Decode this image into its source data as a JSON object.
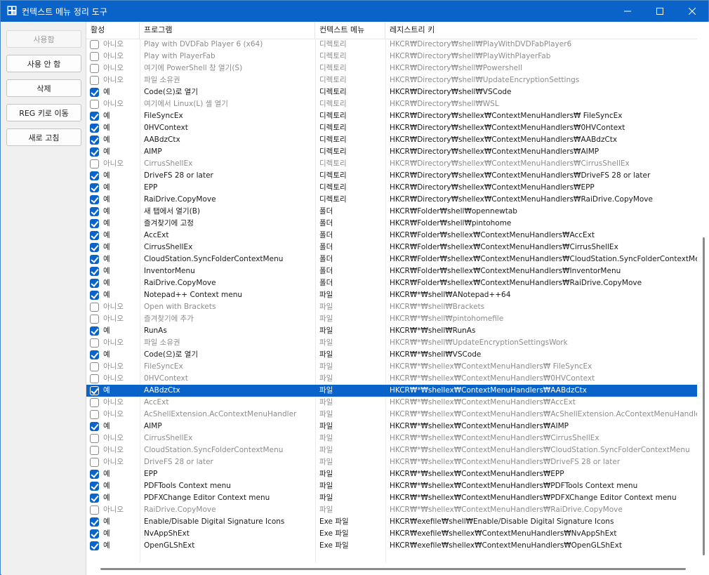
{
  "window": {
    "title": "컨텍스트 메뉴 정리 도구"
  },
  "colors": {
    "accent": "#0a63c9",
    "selection": "#0a63c9",
    "titlebar": "#0a63c9"
  },
  "icons": {
    "app": "registry-cube-icon",
    "minimize": "minimize-icon",
    "maximize": "maximize-icon",
    "close": "close-icon"
  },
  "sidebar": {
    "buttons": [
      {
        "label": "사용함",
        "enabled": false
      },
      {
        "label": "사용 안 함",
        "enabled": true
      },
      {
        "label": "삭제",
        "enabled": true
      },
      {
        "label": "REG 키로 이동",
        "enabled": true
      },
      {
        "label": "새로 고침",
        "enabled": true
      }
    ]
  },
  "table": {
    "columns": [
      "활성",
      "프로그램",
      "컨텍스트 메뉴",
      "레지스트리 키"
    ],
    "rows": [
      {
        "checked": false,
        "active": "아니오",
        "program": "Play with DVDFab Player 6 (x64)",
        "type": "디렉토리",
        "key": "HKCR₩Directory₩shell₩PlayWithDVDFabPlayer6"
      },
      {
        "checked": false,
        "active": "아니오",
        "program": "Play with PlayerFab",
        "type": "디렉토리",
        "key": "HKCR₩Directory₩shell₩PlayWithPlayerFab"
      },
      {
        "checked": false,
        "active": "아니오",
        "program": "여기에 PowerShell 창 열기(S)",
        "type": "디렉토리",
        "key": "HKCR₩Directory₩shell₩Powershell"
      },
      {
        "checked": false,
        "active": "아니오",
        "program": "파일 소유권",
        "type": "디렉토리",
        "key": "HKCR₩Directory₩shell₩UpdateEncryptionSettings"
      },
      {
        "checked": true,
        "active": "예",
        "program": "Code(으)로 열기",
        "type": "디렉토리",
        "key": "HKCR₩Directory₩shell₩VSCode"
      },
      {
        "checked": false,
        "active": "아니오",
        "program": "여기에서 Linux(L) 셸 열기",
        "type": "디렉토리",
        "key": "HKCR₩Directory₩shell₩WSL"
      },
      {
        "checked": true,
        "active": "예",
        "program": " FileSyncEx",
        "type": "디렉토리",
        "key": "HKCR₩Directory₩shellex₩ContextMenuHandlers₩ FileSyncEx"
      },
      {
        "checked": true,
        "active": "예",
        "program": "0HVContext",
        "type": "디렉토리",
        "key": "HKCR₩Directory₩shellex₩ContextMenuHandlers₩0HVContext"
      },
      {
        "checked": true,
        "active": "예",
        "program": "AABdzCtx",
        "type": "디렉토리",
        "key": "HKCR₩Directory₩shellex₩ContextMenuHandlers₩AABdzCtx"
      },
      {
        "checked": true,
        "active": "예",
        "program": "AIMP",
        "type": "디렉토리",
        "key": "HKCR₩Directory₩shellex₩ContextMenuHandlers₩AIMP"
      },
      {
        "checked": false,
        "active": "아니오",
        "program": "CirrusShellEx",
        "type": "디렉토리",
        "key": "HKCR₩Directory₩shellex₩ContextMenuHandlers₩CirrusShellEx"
      },
      {
        "checked": true,
        "active": "예",
        "program": "DriveFS 28 or later",
        "type": "디렉토리",
        "key": "HKCR₩Directory₩shellex₩ContextMenuHandlers₩DriveFS 28 or later"
      },
      {
        "checked": true,
        "active": "예",
        "program": "EPP",
        "type": "디렉토리",
        "key": "HKCR₩Directory₩shellex₩ContextMenuHandlers₩EPP"
      },
      {
        "checked": true,
        "active": "예",
        "program": "RaiDrive.CopyMove",
        "type": "디렉토리",
        "key": "HKCR₩Directory₩shellex₩ContextMenuHandlers₩RaiDrive.CopyMove"
      },
      {
        "checked": true,
        "active": "예",
        "program": "새 탭에서 열기(B)",
        "type": "폴더",
        "key": "HKCR₩Folder₩shell₩opennewtab"
      },
      {
        "checked": true,
        "active": "예",
        "program": "즐겨찾기에 고정",
        "type": "폴더",
        "key": "HKCR₩Folder₩shell₩pintohome"
      },
      {
        "checked": true,
        "active": "예",
        "program": "AccExt",
        "type": "폴더",
        "key": "HKCR₩Folder₩shellex₩ContextMenuHandlers₩AccExt"
      },
      {
        "checked": true,
        "active": "예",
        "program": "CirrusShellEx",
        "type": "폴더",
        "key": "HKCR₩Folder₩shellex₩ContextMenuHandlers₩CirrusShellEx"
      },
      {
        "checked": true,
        "active": "예",
        "program": "CloudStation.SyncFolderContextMenu",
        "type": "폴더",
        "key": "HKCR₩Folder₩shellex₩ContextMenuHandlers₩CloudStation.SyncFolderContextMenu"
      },
      {
        "checked": true,
        "active": "예",
        "program": "InventorMenu",
        "type": "폴더",
        "key": "HKCR₩Folder₩shellex₩ContextMenuHandlers₩InventorMenu"
      },
      {
        "checked": true,
        "active": "예",
        "program": "RaiDrive.CopyMove",
        "type": "폴더",
        "key": "HKCR₩Folder₩shellex₩ContextMenuHandlers₩RaiDrive.CopyMove"
      },
      {
        "checked": true,
        "active": "예",
        "program": "Notepad++ Context menu",
        "type": "파일",
        "key": "HKCR₩*₩shell₩ANotepad++64"
      },
      {
        "checked": false,
        "active": "아니오",
        "program": "Open with Brackets",
        "type": "파일",
        "key": "HKCR₩*₩shell₩Brackets"
      },
      {
        "checked": false,
        "active": "아니오",
        "program": "즐겨찾기에 추가",
        "type": "파일",
        "key": "HKCR₩*₩shell₩pintohomefile"
      },
      {
        "checked": true,
        "active": "예",
        "program": "RunAs",
        "type": "파일",
        "key": "HKCR₩*₩shell₩RunAs"
      },
      {
        "checked": false,
        "active": "아니오",
        "program": "파일 소유권",
        "type": "파일",
        "key": "HKCR₩*₩shell₩UpdateEncryptionSettingsWork"
      },
      {
        "checked": true,
        "active": "예",
        "program": "Code(으)로 열기",
        "type": "파일",
        "key": "HKCR₩*₩shell₩VSCode"
      },
      {
        "checked": false,
        "active": "아니오",
        "program": " FileSyncEx",
        "type": "파일",
        "key": "HKCR₩*₩shellex₩ContextMenuHandlers₩ FileSyncEx"
      },
      {
        "checked": false,
        "active": "아니오",
        "program": "0HVContext",
        "type": "파일",
        "key": "HKCR₩*₩shellex₩ContextMenuHandlers₩0HVContext"
      },
      {
        "checked": true,
        "active": "예",
        "program": "AABdzCtx",
        "type": "파일",
        "key": "HKCR₩*₩shellex₩ContextMenuHandlers₩AABdzCtx",
        "selected": true
      },
      {
        "checked": false,
        "active": "아니오",
        "program": "AccExt",
        "type": "파일",
        "key": "HKCR₩*₩shellex₩ContextMenuHandlers₩AccExt"
      },
      {
        "checked": false,
        "active": "아니오",
        "program": "AcShellExtension.AcContextMenuHandler",
        "type": "파일",
        "key": "HKCR₩*₩shellex₩ContextMenuHandlers₩AcShellExtension.AcContextMenuHandler"
      },
      {
        "checked": true,
        "active": "예",
        "program": "AIMP",
        "type": "파일",
        "key": "HKCR₩*₩shellex₩ContextMenuHandlers₩AIMP"
      },
      {
        "checked": false,
        "active": "아니오",
        "program": "CirrusShellEx",
        "type": "파일",
        "key": "HKCR₩*₩shellex₩ContextMenuHandlers₩CirrusShellEx"
      },
      {
        "checked": false,
        "active": "아니오",
        "program": "CloudStation.SyncFolderContextMenu",
        "type": "파일",
        "key": "HKCR₩*₩shellex₩ContextMenuHandlers₩CloudStation.SyncFolderContextMenu"
      },
      {
        "checked": false,
        "active": "아니오",
        "program": "DriveFS 28 or later",
        "type": "파일",
        "key": "HKCR₩*₩shellex₩ContextMenuHandlers₩DriveFS 28 or later"
      },
      {
        "checked": true,
        "active": "예",
        "program": "EPP",
        "type": "파일",
        "key": "HKCR₩*₩shellex₩ContextMenuHandlers₩EPP"
      },
      {
        "checked": true,
        "active": "예",
        "program": "PDFTools Context menu",
        "type": "파일",
        "key": "HKCR₩*₩shellex₩ContextMenuHandlers₩PDFTools Context menu"
      },
      {
        "checked": true,
        "active": "예",
        "program": "PDFXChange Editor Context menu",
        "type": "파일",
        "key": "HKCR₩*₩shellex₩ContextMenuHandlers₩PDFXChange Editor Context menu"
      },
      {
        "checked": false,
        "active": "아니오",
        "program": "RaiDrive.CopyMove",
        "type": "파일",
        "key": "HKCR₩*₩shellex₩ContextMenuHandlers₩RaiDrive.CopyMove"
      },
      {
        "checked": true,
        "active": "예",
        "program": "Enable/Disable Digital Signature Icons",
        "type": "Exe 파일",
        "key": "HKCR₩exefile₩shell₩Enable/Disable Digital Signature Icons"
      },
      {
        "checked": true,
        "active": "예",
        "program": "NvAppShExt",
        "type": "Exe 파일",
        "key": "HKCR₩exefile₩shellex₩ContextMenuHandlers₩NvAppShExt"
      },
      {
        "checked": true,
        "active": "예",
        "program": "OpenGLShExt",
        "type": "Exe 파일",
        "key": "HKCR₩exefile₩shellex₩ContextMenuHandlers₩OpenGLShExt"
      }
    ]
  }
}
